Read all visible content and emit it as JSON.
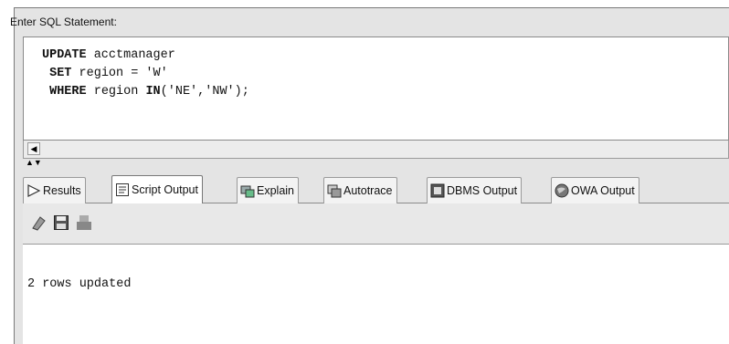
{
  "editor_label": "Enter SQL Statement:",
  "sql": {
    "line1_kw": "UPDATE",
    "line1_rest": " acctmanager",
    "line2_kw": "SET",
    "line2_rest": " region = 'W'",
    "line3_kw": "WHERE",
    "line3_mid": " region ",
    "line3_kw2": "IN",
    "line3_rest": "('NE','NW');"
  },
  "tabs": [
    {
      "label": "Results",
      "icon": "play-arrow-icon"
    },
    {
      "label": "Script Output",
      "icon": "script-icon"
    },
    {
      "label": "Explain",
      "icon": "explain-icon"
    },
    {
      "label": "Autotrace",
      "icon": "autotrace-icon"
    },
    {
      "label": "DBMS Output",
      "icon": "dbms-icon"
    },
    {
      "label": "OWA Output",
      "icon": "globe-icon"
    }
  ],
  "toolbar": {
    "icons": [
      "eraser-icon",
      "save-icon",
      "print-icon"
    ]
  },
  "output": {
    "text": "2 rows updated"
  },
  "colors": {
    "panel_bg": "#e4e4e4",
    "editor_bg": "#ffffff",
    "border": "#8a8a8a"
  }
}
